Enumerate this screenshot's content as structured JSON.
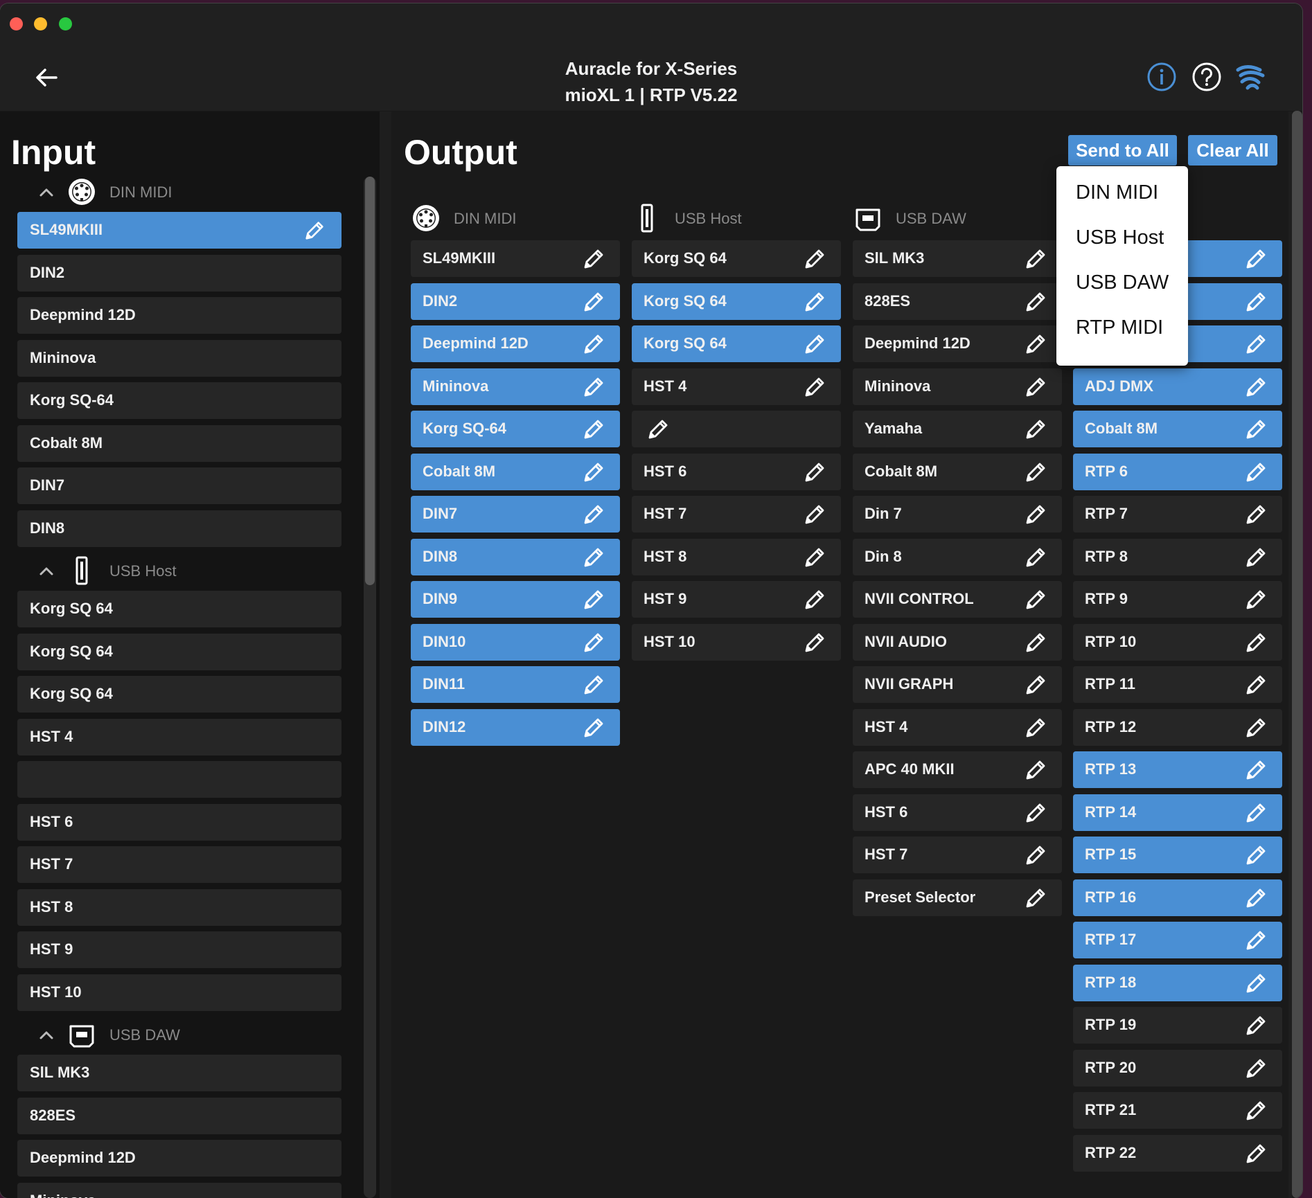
{
  "window": {
    "controls": [
      "close",
      "minimize",
      "zoom"
    ]
  },
  "header": {
    "title_line1": "Auracle for X-Series",
    "title_line2": "mioXL 1  |  RTP V5.22",
    "back_icon": "arrow-left-icon",
    "icons": [
      "info-icon",
      "help-icon",
      "logo-icon"
    ],
    "accent": "#4a8fd4"
  },
  "input": {
    "title": "Input",
    "sections": [
      {
        "name": "DIN MIDI",
        "icon": "din-midi-icon",
        "items": [
          {
            "label": "SL49MKIII",
            "selected": true
          },
          {
            "label": "DIN2"
          },
          {
            "label": "Deepmind 12D"
          },
          {
            "label": "Mininova"
          },
          {
            "label": "Korg SQ-64"
          },
          {
            "label": "Cobalt 8M"
          },
          {
            "label": "DIN7"
          },
          {
            "label": "DIN8"
          }
        ]
      },
      {
        "name": "USB Host",
        "icon": "usb-host-icon",
        "items": [
          {
            "label": "Korg SQ 64"
          },
          {
            "label": "Korg SQ 64"
          },
          {
            "label": "Korg SQ 64"
          },
          {
            "label": "HST 4"
          },
          {
            "label": ""
          },
          {
            "label": "HST 6"
          },
          {
            "label": "HST 7"
          },
          {
            "label": "HST 8"
          },
          {
            "label": "HST 9"
          },
          {
            "label": "HST 10"
          }
        ]
      },
      {
        "name": "USB DAW",
        "icon": "usb-daw-icon",
        "items": [
          {
            "label": "SlL MK3"
          },
          {
            "label": "828ES"
          },
          {
            "label": "Deepmind 12D"
          },
          {
            "label": "Mininova"
          }
        ]
      }
    ]
  },
  "output": {
    "title": "Output",
    "send_all_label": "Send to All",
    "clear_all_label": "Clear All",
    "columns": [
      {
        "name": "DIN MIDI",
        "icon": "din-midi-icon",
        "items": [
          {
            "label": "SL49MKIII",
            "selected": false
          },
          {
            "label": "DIN2",
            "selected": true
          },
          {
            "label": "Deepmind 12D",
            "selected": true
          },
          {
            "label": "Mininova",
            "selected": true
          },
          {
            "label": "Korg SQ-64",
            "selected": true
          },
          {
            "label": "Cobalt 8M",
            "selected": true
          },
          {
            "label": "DIN7",
            "selected": true
          },
          {
            "label": "DIN8",
            "selected": true
          },
          {
            "label": "DIN9",
            "selected": true
          },
          {
            "label": "DIN10",
            "selected": true
          },
          {
            "label": "DIN11",
            "selected": true
          },
          {
            "label": "DIN12",
            "selected": true
          }
        ]
      },
      {
        "name": "USB Host",
        "icon": "usb-host-icon",
        "items": [
          {
            "label": "Korg SQ 64",
            "selected": false
          },
          {
            "label": "Korg SQ 64",
            "selected": true
          },
          {
            "label": "Korg SQ 64",
            "selected": true
          },
          {
            "label": "HST 4",
            "selected": false
          },
          {
            "label": "",
            "selected": false
          },
          {
            "label": "HST 6",
            "selected": false
          },
          {
            "label": "HST 7",
            "selected": false
          },
          {
            "label": "HST 8",
            "selected": false
          },
          {
            "label": "HST 9",
            "selected": false
          },
          {
            "label": "HST 10",
            "selected": false
          }
        ]
      },
      {
        "name": "USB DAW",
        "icon": "usb-daw-icon",
        "items": [
          {
            "label": "SlL MK3"
          },
          {
            "label": "828ES"
          },
          {
            "label": "Deepmind 12D"
          },
          {
            "label": "Mininova"
          },
          {
            "label": "Yamaha"
          },
          {
            "label": "Cobalt 8M"
          },
          {
            "label": "Din 7"
          },
          {
            "label": "Din 8"
          },
          {
            "label": "NVII CONTROL"
          },
          {
            "label": "NVII AUDIO"
          },
          {
            "label": "NVII GRAPH"
          },
          {
            "label": "HST 4"
          },
          {
            "label": "APC 40 MKII"
          },
          {
            "label": "HST 6"
          },
          {
            "label": "HST 7"
          },
          {
            "label": "Preset Selector"
          }
        ]
      },
      {
        "name": "",
        "icon": "",
        "items": [
          {
            "label": "",
            "selected": true
          },
          {
            "label": "",
            "selected": true
          },
          {
            "label": "",
            "selected": true
          },
          {
            "label": "ADJ DMX",
            "selected": true
          },
          {
            "label": "Cobalt 8M",
            "selected": true
          },
          {
            "label": "RTP 6",
            "selected": true
          },
          {
            "label": "RTP 7"
          },
          {
            "label": "RTP 8"
          },
          {
            "label": "RTP 9"
          },
          {
            "label": "RTP 10"
          },
          {
            "label": "RTP 11"
          },
          {
            "label": "RTP 12"
          },
          {
            "label": "RTP 13",
            "selected": true
          },
          {
            "label": "RTP 14",
            "selected": true
          },
          {
            "label": "RTP 15",
            "selected": true
          },
          {
            "label": "RTP 16",
            "selected": true
          },
          {
            "label": "RTP 17",
            "selected": true
          },
          {
            "label": "RTP 18",
            "selected": true
          },
          {
            "label": "RTP 19"
          },
          {
            "label": "RTP 20"
          },
          {
            "label": "RTP 21"
          },
          {
            "label": "RTP 22"
          }
        ]
      }
    ]
  },
  "dropdown": {
    "items": [
      "DIN MIDI",
      "USB Host",
      "USB DAW",
      "RTP MIDI"
    ]
  }
}
